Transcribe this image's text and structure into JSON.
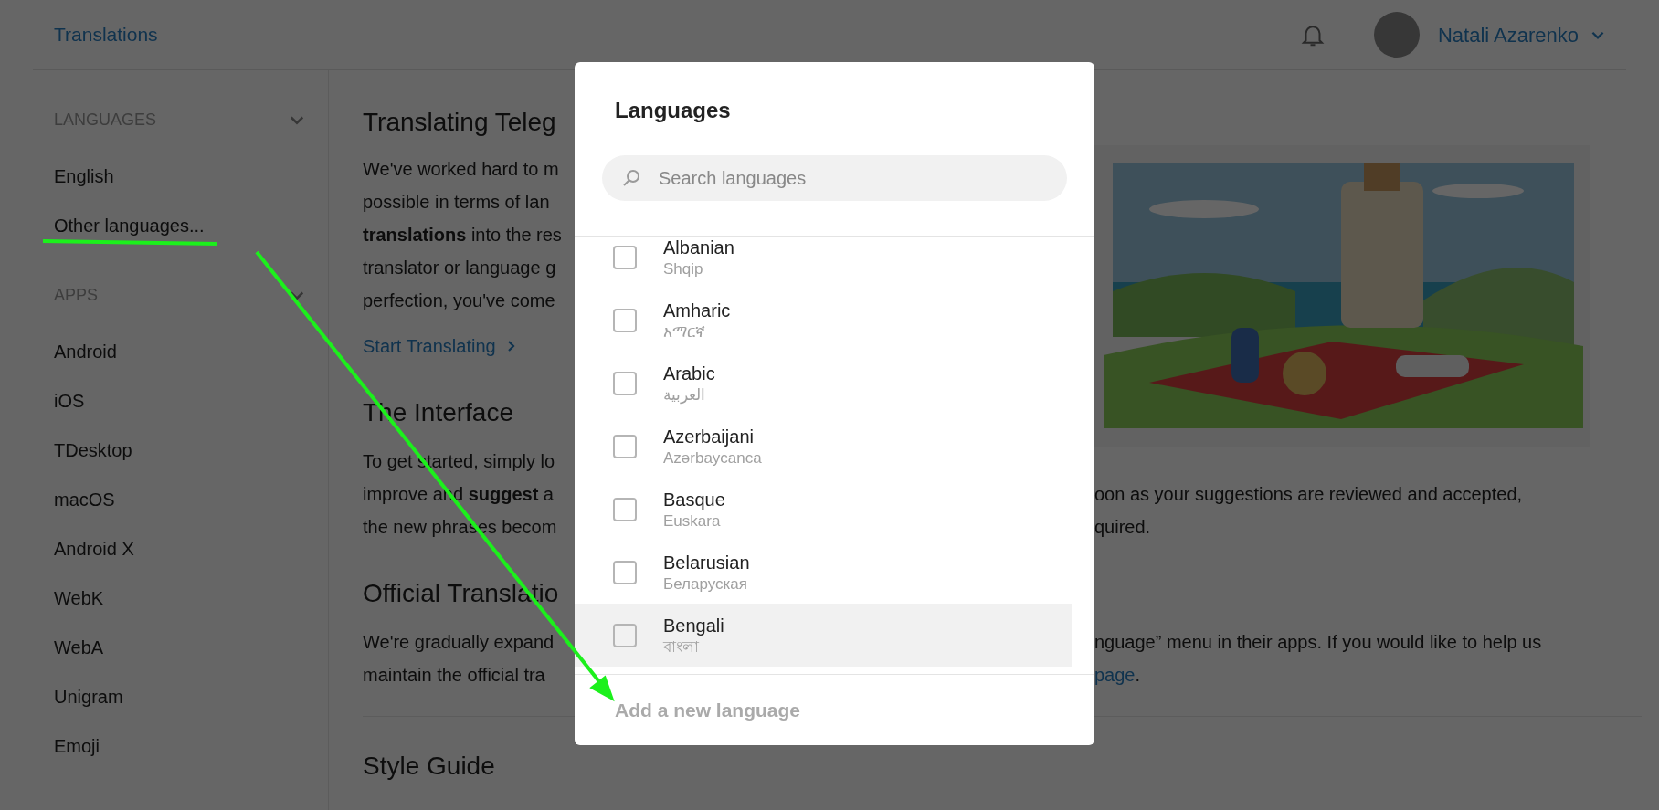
{
  "header": {
    "title": "Translations",
    "user": {
      "name": "Natali Azarenko"
    }
  },
  "sidebar": {
    "sections": [
      {
        "title": "LANGUAGES",
        "expanded": true,
        "items": [
          {
            "label": "English"
          },
          {
            "label": "Other languages..."
          }
        ]
      },
      {
        "title": "APPS",
        "expanded": true,
        "items": [
          {
            "label": "Android"
          },
          {
            "label": "iOS"
          },
          {
            "label": "TDesktop"
          },
          {
            "label": "macOS"
          },
          {
            "label": "Android X"
          },
          {
            "label": "WebK"
          },
          {
            "label": "WebA"
          },
          {
            "label": "Unigram"
          },
          {
            "label": "Emoji"
          }
        ]
      }
    ]
  },
  "article": {
    "intro": {
      "title": "Translating Teleg",
      "lines": [
        "We've worked hard to m",
        "possible in terms of lan",
        "**translations** into the res",
        "translator or language g",
        "perfection, you've come"
      ],
      "link": "Start Translating"
    },
    "sections": [
      {
        "heading": "The Interface",
        "lines": [
          {
            "left": "To get started, simply lo"
          },
          {
            "left": "improve and **suggest** a",
            "right": "oon as your suggestions are reviewed and accepted,"
          },
          {
            "left": "the new phrases becom",
            "right": "quired."
          }
        ]
      },
      {
        "heading": "Official Translatio",
        "lines": [
          {
            "left": "We're gradually expand",
            "right": "nguage” menu in their apps. If you would like to help us"
          },
          {
            "left": "maintain the official tra",
            "right_link": "page",
            "right": "."
          }
        ]
      },
      {
        "heading": "Style Guide"
      }
    ]
  },
  "dialog": {
    "title": "Languages",
    "search": {
      "placeholder": "Search languages"
    },
    "languages": [
      {
        "name": "Albanian",
        "native": "Shqip",
        "checked": false,
        "highlighted": false
      },
      {
        "name": "Amharic",
        "native": "አማርኛ",
        "checked": false,
        "highlighted": false
      },
      {
        "name": "Arabic",
        "native": "العربية",
        "checked": false,
        "highlighted": false
      },
      {
        "name": "Azerbaijani",
        "native": "Azərbaycanca",
        "checked": false,
        "highlighted": false
      },
      {
        "name": "Basque",
        "native": "Euskara",
        "checked": false,
        "highlighted": false
      },
      {
        "name": "Belarusian",
        "native": "Беларуская",
        "checked": false,
        "highlighted": false
      },
      {
        "name": "Bengali",
        "native": "বাংলা",
        "checked": false,
        "highlighted": true
      }
    ],
    "add_link": "Add a new language"
  }
}
